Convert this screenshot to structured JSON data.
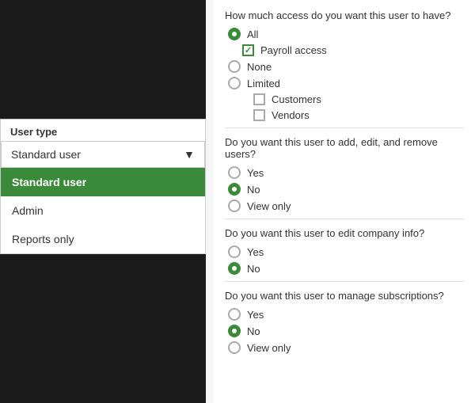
{
  "left": {
    "user_type_label": "User type",
    "dropdown_value": "Standard user",
    "dropdown_arrow": "▼",
    "options": [
      {
        "label": "Standard user",
        "active": true
      },
      {
        "label": "Admin",
        "active": false
      },
      {
        "label": "Reports only",
        "active": false
      }
    ]
  },
  "right": {
    "section1": {
      "question": "How much access do you want this user to have?",
      "options": [
        {
          "type": "radio",
          "label": "All",
          "selected": true,
          "indent": 0
        },
        {
          "type": "checkbox",
          "label": "Payroll access",
          "checked": true,
          "indent": 1
        },
        {
          "type": "radio",
          "label": "None",
          "selected": false,
          "indent": 0
        },
        {
          "type": "radio",
          "label": "Limited",
          "selected": false,
          "indent": 0
        },
        {
          "type": "checkbox",
          "label": "Customers",
          "checked": false,
          "indent": 2
        },
        {
          "type": "checkbox",
          "label": "Vendors",
          "checked": false,
          "indent": 2
        }
      ]
    },
    "section2": {
      "question": "Do you want this user to add, edit, and remove users?",
      "options": [
        {
          "label": "Yes",
          "selected": false
        },
        {
          "label": "No",
          "selected": true
        },
        {
          "label": "View only",
          "selected": false
        }
      ]
    },
    "section3": {
      "question": "Do you want this user to edit company info?",
      "options": [
        {
          "label": "Yes",
          "selected": false
        },
        {
          "label": "No",
          "selected": true
        }
      ]
    },
    "section4": {
      "question": "Do you want this user to manage subscriptions?",
      "options": [
        {
          "label": "Yes",
          "selected": false
        },
        {
          "label": "No",
          "selected": true
        },
        {
          "label": "View only",
          "selected": false
        }
      ]
    }
  }
}
